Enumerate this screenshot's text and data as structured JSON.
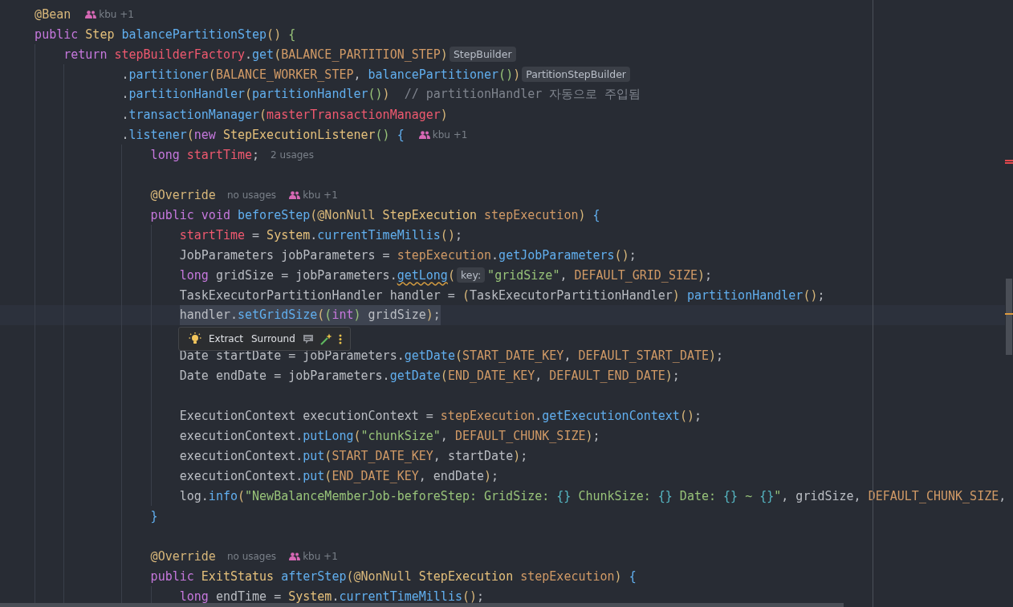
{
  "lines": [
    {
      "current": false,
      "tokens": [
        {
          "text": "@Bean",
          "kind": "ann"
        },
        {
          "text": "kbu +1",
          "kind": "author"
        }
      ]
    },
    {
      "current": false,
      "tokens": [
        {
          "text": "public",
          "kind": "kw"
        },
        {
          "text": " Step",
          "kind": "type"
        },
        {
          "text": " balancePartitionStep",
          "kind": "method"
        },
        {
          "text": "()",
          "kind": "b1"
        },
        {
          "text": " {",
          "kind": "b2"
        }
      ],
      "children": [
        {
          "current": false,
          "tokens": [
            {
              "text": "return",
              "kind": "kw"
            },
            {
              "text": " stepBuilderFactory",
              "kind": "field"
            },
            {
              "text": ".",
              "kind": "plain"
            },
            {
              "text": "get",
              "kind": "method"
            },
            {
              "text": "(",
              "kind": "b1"
            },
            {
              "text": "BALANCE_PARTITION_STEP",
              "kind": "const"
            },
            {
              "text": ")",
              "kind": "b1"
            },
            {
              "text": "StepBuilder",
              "kind": "hint"
            }
          ],
          "children": [
            {
              "current": false,
              "tokens": [
                {
                  "text": ".",
                  "kind": "plain"
                },
                {
                  "text": "partitioner",
                  "kind": "method"
                },
                {
                  "text": "(",
                  "kind": "b1"
                },
                {
                  "text": "BALANCE_WORKER_STEP",
                  "kind": "const"
                },
                {
                  "text": ", ",
                  "kind": "plain"
                },
                {
                  "text": "balancePartitioner",
                  "kind": "method"
                },
                {
                  "text": "()",
                  "kind": "b2"
                },
                {
                  "text": ")",
                  "kind": "b1"
                },
                {
                  "text": "PartitionStepBuilder",
                  "kind": "hint"
                }
              ]
            },
            {
              "current": false,
              "tokens": [
                {
                  "text": ".",
                  "kind": "plain"
                },
                {
                  "text": "partitionHandler",
                  "kind": "method"
                },
                {
                  "text": "(",
                  "kind": "b1"
                },
                {
                  "text": "partitionHandler",
                  "kind": "method"
                },
                {
                  "text": "()",
                  "kind": "b2"
                },
                {
                  "text": ")",
                  "kind": "b1"
                },
                {
                  "text": "  // partitionHandler 자동으로 주입됨",
                  "kind": "comment"
                }
              ]
            },
            {
              "current": false,
              "tokens": [
                {
                  "text": ".",
                  "kind": "plain"
                },
                {
                  "text": "transactionManager",
                  "kind": "method"
                },
                {
                  "text": "(",
                  "kind": "b1"
                },
                {
                  "text": "masterTransactionManager",
                  "kind": "field"
                },
                {
                  "text": ")",
                  "kind": "b1"
                }
              ]
            },
            {
              "current": false,
              "tokens": [
                {
                  "text": ".",
                  "kind": "plain"
                },
                {
                  "text": "listener",
                  "kind": "method"
                },
                {
                  "text": "(",
                  "kind": "b1"
                },
                {
                  "text": "new",
                  "kind": "kw"
                },
                {
                  "text": " StepExecutionListener",
                  "kind": "type"
                },
                {
                  "text": "()",
                  "kind": "b2"
                },
                {
                  "text": " {",
                  "kind": "b3"
                },
                {
                  "text": "kbu +1",
                  "kind": "author"
                }
              ],
              "children": [
                {
                  "current": false,
                  "tokens": [
                    {
                      "text": "long",
                      "kind": "kw"
                    },
                    {
                      "text": " startTime",
                      "kind": "field"
                    },
                    {
                      "text": ";",
                      "kind": "plain"
                    },
                    {
                      "text": "2 usages",
                      "kind": "usage"
                    }
                  ]
                },
                {
                  "current": false
                },
                {
                  "current": false,
                  "tokens": [
                    {
                      "text": "@Override",
                      "kind": "ann"
                    },
                    {
                      "text": "no usages",
                      "kind": "usage"
                    },
                    {
                      "text": "kbu +1",
                      "kind": "author"
                    }
                  ]
                },
                {
                  "current": false,
                  "tokens": [
                    {
                      "text": "public",
                      "kind": "kw"
                    },
                    {
                      "text": " void",
                      "kind": "kw"
                    },
                    {
                      "text": " beforeStep",
                      "kind": "method"
                    },
                    {
                      "text": "(",
                      "kind": "b1"
                    },
                    {
                      "text": "@NonNull",
                      "kind": "ann"
                    },
                    {
                      "text": " StepExecution",
                      "kind": "type"
                    },
                    {
                      "text": " stepExecution",
                      "kind": "param"
                    },
                    {
                      "text": ")",
                      "kind": "b1"
                    },
                    {
                      "text": " {",
                      "kind": "b3"
                    }
                  ],
                  "children": [
                    {
                      "current": false,
                      "tokens": [
                        {
                          "text": "startTime",
                          "kind": "field"
                        },
                        {
                          "text": " = ",
                          "kind": "plain"
                        },
                        {
                          "text": "System",
                          "kind": "type"
                        },
                        {
                          "text": ".",
                          "kind": "plain"
                        },
                        {
                          "text": "currentTimeMillis",
                          "kind": "method"
                        },
                        {
                          "text": "()",
                          "kind": "b1"
                        },
                        {
                          "text": ";",
                          "kind": "plain"
                        }
                      ]
                    },
                    {
                      "current": false,
                      "tokens": [
                        {
                          "text": "JobParameters jobParameters = ",
                          "kind": "plain"
                        },
                        {
                          "text": "stepExecution",
                          "kind": "param"
                        },
                        {
                          "text": ".",
                          "kind": "plain"
                        },
                        {
                          "text": "getJobParameters",
                          "kind": "method"
                        },
                        {
                          "text": "()",
                          "kind": "b1"
                        },
                        {
                          "text": ";",
                          "kind": "plain"
                        }
                      ]
                    },
                    {
                      "current": false,
                      "tokens": [
                        {
                          "text": "long",
                          "kind": "kw"
                        },
                        {
                          "text": " gridSize = jobParameters.",
                          "kind": "plain"
                        },
                        {
                          "text": "getLong",
                          "kind": "method_warn"
                        },
                        {
                          "text": "(",
                          "kind": "b1"
                        },
                        {
                          "text": "key:",
                          "kind": "hint"
                        },
                        {
                          "text": "\"gridSize\"",
                          "kind": "str"
                        },
                        {
                          "text": ", ",
                          "kind": "plain"
                        },
                        {
                          "text": "DEFAULT_GRID_SIZE",
                          "kind": "const"
                        },
                        {
                          "text": ")",
                          "kind": "b1"
                        },
                        {
                          "text": ";",
                          "kind": "plain"
                        }
                      ]
                    },
                    {
                      "current": false,
                      "tokens": [
                        {
                          "text": "TaskExecutorPartitionHandler handler = ",
                          "kind": "plain"
                        },
                        {
                          "text": "(",
                          "kind": "b1"
                        },
                        {
                          "text": "TaskExecutorPartitionHandler",
                          "kind": "plain"
                        },
                        {
                          "text": ")",
                          "kind": "b1"
                        },
                        {
                          "text": " partitionHandler",
                          "kind": "method"
                        },
                        {
                          "text": "()",
                          "kind": "b1"
                        },
                        {
                          "text": ";",
                          "kind": "plain"
                        }
                      ]
                    },
                    {
                      "current": true,
                      "tokens": [
                        {
                          "text": "handler.",
                          "kind": "plain"
                        },
                        {
                          "text": "setGridSize",
                          "kind": "method"
                        },
                        {
                          "text": "(",
                          "kind": "b1"
                        },
                        {
                          "text": "(",
                          "kind": "b2"
                        },
                        {
                          "text": "int",
                          "kind": "kw"
                        },
                        {
                          "text": ")",
                          "kind": "b2"
                        },
                        {
                          "text": " gridSize",
                          "kind": "plain"
                        },
                        {
                          "text": ")",
                          "kind": "b1"
                        },
                        {
                          "text": ";",
                          "kind": "plain"
                        }
                      ]
                    },
                    {
                      "current": false
                    },
                    {
                      "current": false,
                      "tokens": [
                        {
                          "text": "Date startDate = jobParameters.",
                          "kind": "plain"
                        },
                        {
                          "text": "getDate",
                          "kind": "method"
                        },
                        {
                          "text": "(",
                          "kind": "b1"
                        },
                        {
                          "text": "START_DATE_KEY",
                          "kind": "const"
                        },
                        {
                          "text": ", ",
                          "kind": "plain"
                        },
                        {
                          "text": "DEFAULT_START_DATE",
                          "kind": "const"
                        },
                        {
                          "text": ")",
                          "kind": "b1"
                        },
                        {
                          "text": ";",
                          "kind": "plain"
                        }
                      ]
                    },
                    {
                      "current": false,
                      "tokens": [
                        {
                          "text": "Date endDate = jobParameters.",
                          "kind": "plain"
                        },
                        {
                          "text": "getDate",
                          "kind": "method"
                        },
                        {
                          "text": "(",
                          "kind": "b1"
                        },
                        {
                          "text": "END_DATE_KEY",
                          "kind": "const"
                        },
                        {
                          "text": ", ",
                          "kind": "plain"
                        },
                        {
                          "text": "DEFAULT_END_DATE",
                          "kind": "const"
                        },
                        {
                          "text": ")",
                          "kind": "b1"
                        },
                        {
                          "text": ";",
                          "kind": "plain"
                        }
                      ]
                    },
                    {
                      "current": false
                    },
                    {
                      "current": false,
                      "tokens": [
                        {
                          "text": "ExecutionContext executionContext = ",
                          "kind": "plain"
                        },
                        {
                          "text": "stepExecution",
                          "kind": "param"
                        },
                        {
                          "text": ".",
                          "kind": "plain"
                        },
                        {
                          "text": "getExecutionContext",
                          "kind": "method"
                        },
                        {
                          "text": "()",
                          "kind": "b1"
                        },
                        {
                          "text": ";",
                          "kind": "plain"
                        }
                      ]
                    },
                    {
                      "current": false,
                      "tokens": [
                        {
                          "text": "executionContext.",
                          "kind": "plain"
                        },
                        {
                          "text": "putLong",
                          "kind": "method"
                        },
                        {
                          "text": "(",
                          "kind": "b1"
                        },
                        {
                          "text": "\"chunkSize\"",
                          "kind": "str"
                        },
                        {
                          "text": ", ",
                          "kind": "plain"
                        },
                        {
                          "text": "DEFAULT_CHUNK_SIZE",
                          "kind": "const"
                        },
                        {
                          "text": ")",
                          "kind": "b1"
                        },
                        {
                          "text": ";",
                          "kind": "plain"
                        }
                      ]
                    },
                    {
                      "current": false,
                      "tokens": [
                        {
                          "text": "executionContext.",
                          "kind": "plain"
                        },
                        {
                          "text": "put",
                          "kind": "method"
                        },
                        {
                          "text": "(",
                          "kind": "b1"
                        },
                        {
                          "text": "START_DATE_KEY",
                          "kind": "const"
                        },
                        {
                          "text": ", startDate",
                          "kind": "plain"
                        },
                        {
                          "text": ")",
                          "kind": "b1"
                        },
                        {
                          "text": ";",
                          "kind": "plain"
                        }
                      ]
                    },
                    {
                      "current": false,
                      "tokens": [
                        {
                          "text": "executionContext.",
                          "kind": "plain"
                        },
                        {
                          "text": "put",
                          "kind": "method"
                        },
                        {
                          "text": "(",
                          "kind": "b1"
                        },
                        {
                          "text": "END_DATE_KEY",
                          "kind": "const"
                        },
                        {
                          "text": ", endDate",
                          "kind": "plain"
                        },
                        {
                          "text": ")",
                          "kind": "b1"
                        },
                        {
                          "text": ";",
                          "kind": "plain"
                        }
                      ]
                    },
                    {
                      "current": false,
                      "tokens": [
                        {
                          "text": "log.",
                          "kind": "plain"
                        },
                        {
                          "text": "info",
                          "kind": "method"
                        },
                        {
                          "text": "(",
                          "kind": "b1"
                        },
                        {
                          "text": "\"NewBalanceMemberJob-beforeStep: GridSize: ",
                          "kind": "str"
                        },
                        {
                          "text": "{}",
                          "kind": "ph"
                        },
                        {
                          "text": " ChunkSize: ",
                          "kind": "str"
                        },
                        {
                          "text": "{}",
                          "kind": "ph"
                        },
                        {
                          "text": " Date: ",
                          "kind": "str"
                        },
                        {
                          "text": "{}",
                          "kind": "ph"
                        },
                        {
                          "text": " ~ ",
                          "kind": "str"
                        },
                        {
                          "text": "{}",
                          "kind": "ph"
                        },
                        {
                          "text": "\"",
                          "kind": "str"
                        },
                        {
                          "text": ", gridSize, ",
                          "kind": "plain"
                        },
                        {
                          "text": "DEFAULT_CHUNK_SIZE",
                          "kind": "const"
                        },
                        {
                          "text": ",",
                          "kind": "plain"
                        }
                      ]
                    }
                  ]
                },
                {
                  "current": false,
                  "tokens": [
                    {
                      "text": "}",
                      "kind": "b3"
                    }
                  ]
                },
                {
                  "current": false
                },
                {
                  "current": false,
                  "tokens": [
                    {
                      "text": "@Override",
                      "kind": "ann"
                    },
                    {
                      "text": "no usages",
                      "kind": "usage"
                    },
                    {
                      "text": "kbu +1",
                      "kind": "author"
                    }
                  ]
                },
                {
                  "current": false,
                  "tokens": [
                    {
                      "text": "public",
                      "kind": "kw"
                    },
                    {
                      "text": " ExitStatus",
                      "kind": "type"
                    },
                    {
                      "text": " afterStep",
                      "kind": "method"
                    },
                    {
                      "text": "(",
                      "kind": "b1"
                    },
                    {
                      "text": "@NonNull",
                      "kind": "ann"
                    },
                    {
                      "text": " StepExecution",
                      "kind": "type"
                    },
                    {
                      "text": " stepExecution",
                      "kind": "param"
                    },
                    {
                      "text": ")",
                      "kind": "b1"
                    },
                    {
                      "text": " {",
                      "kind": "b3"
                    }
                  ],
                  "children": [
                    {
                      "current": false,
                      "tokens": [
                        {
                          "text": "long",
                          "kind": "kw"
                        },
                        {
                          "text": " endTime = ",
                          "kind": "plain"
                        },
                        {
                          "text": "System",
                          "kind": "type"
                        },
                        {
                          "text": ".",
                          "kind": "plain"
                        },
                        {
                          "text": "currentTimeMillis",
                          "kind": "method"
                        },
                        {
                          "text": "()",
                          "kind": "b1"
                        },
                        {
                          "text": ";",
                          "kind": "plain"
                        }
                      ]
                    }
                  ]
                }
              ]
            }
          ]
        }
      ]
    }
  ],
  "action_bar": {
    "actions": [
      "Extract",
      "Surround"
    ]
  }
}
